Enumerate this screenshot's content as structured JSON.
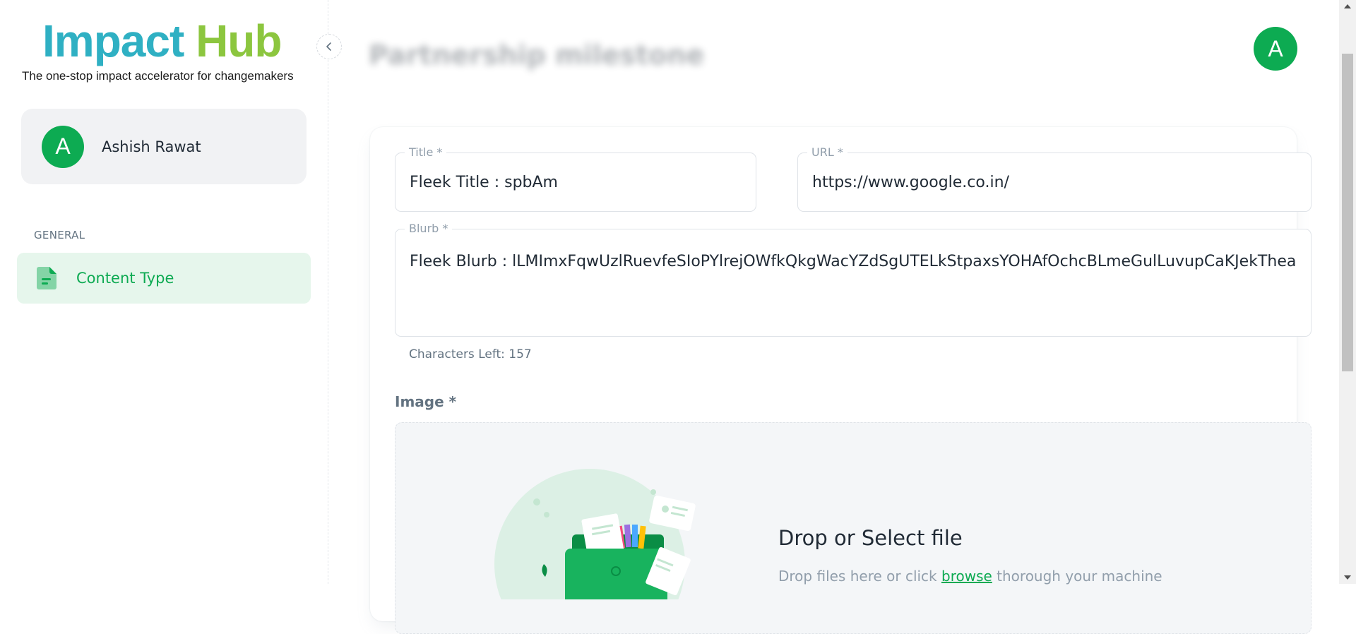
{
  "brand": {
    "word1": "Impact",
    "word2": "Hub",
    "tagline": "The one-stop impact accelerator for changemakers",
    "colors": {
      "primary": "#2fb0c3",
      "secondary": "#8cc63f"
    }
  },
  "sidebar": {
    "collapse_icon": "chevron-left-icon",
    "user": {
      "avatar_letter": "A",
      "name": "Ashish Rawat"
    },
    "section_label": "GENERAL",
    "items": [
      {
        "label": "Content Type",
        "icon": "file-icon",
        "active": true
      }
    ]
  },
  "header": {
    "title": "Partnership milestone",
    "avatar_letter": "A"
  },
  "form": {
    "title": {
      "label": "Title *",
      "value": "Fleek Title : spbAm"
    },
    "url": {
      "label": "URL *",
      "value": "https://www.google.co.in/"
    },
    "blurb": {
      "label": "Blurb *",
      "value": "Fleek Blurb : lLMImxFqwUzlRuevfeSIoPYlrejOWfkQkgWacYZdSgUTELkStpaxsYOHAfOchcBLmeGulLuvupCaKJekThea"
    },
    "chars_left": "Characters Left: 157",
    "image_label": "Image *",
    "dropzone": {
      "title": "Drop or Select file",
      "sub_before": "Drop files here or click",
      "browse": "browse",
      "sub_after": "thorough your machine"
    }
  },
  "theme": {
    "accent": "#0dab52",
    "accent_light": "#e6f6ec"
  }
}
